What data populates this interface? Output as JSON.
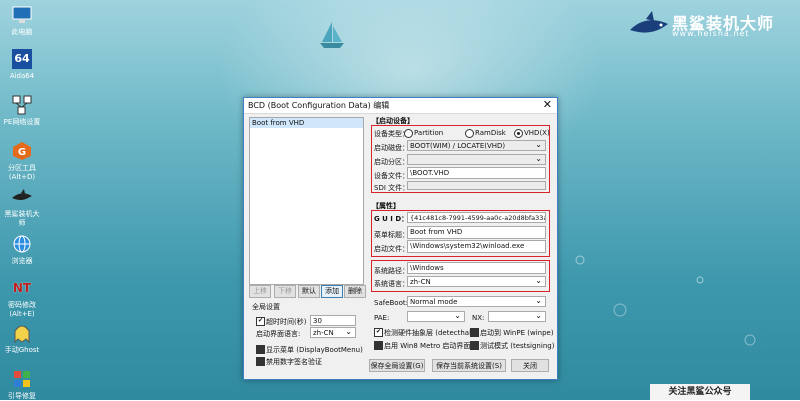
{
  "desktop": {
    "icons": [
      {
        "label": "此电脑",
        "icon": "computer-icon"
      },
      {
        "label": "Aida64",
        "icon": "aida64-icon",
        "glyph": "64"
      },
      {
        "label": "PE网络设置",
        "icon": "network-icon"
      },
      {
        "label": "分区工具\n(Alt+D)",
        "icon": "partition-tool-icon"
      },
      {
        "label": "黑鲨装机大\n师",
        "icon": "shark-installer-icon"
      },
      {
        "label": "浏览器",
        "icon": "browser-icon"
      },
      {
        "label": "密码修改\n(Alt+E)",
        "icon": "password-icon",
        "glyph": "NT"
      },
      {
        "label": "手动Ghost",
        "icon": "ghost-icon"
      },
      {
        "label": "引导修复",
        "icon": "boot-repair-icon"
      }
    ],
    "logo_title": "黑鲨装机大师",
    "logo_url": "www.heisha.net",
    "promo": "关注黑鲨公众号"
  },
  "window": {
    "title": "BCD (Boot Configuration Data) 编辑",
    "close": "✕",
    "list_items": [
      "Boot from VHD"
    ],
    "buttons": {
      "up": "上移",
      "down": "下移",
      "default": "默认",
      "add": "添加",
      "delete": "删除"
    },
    "global": {
      "title": "全局设置",
      "timeout_label": "超时时间(秒)",
      "timeout_value": "30",
      "menu_lang_label": "启动界面语言:",
      "menu_lang_value": "zh-CN",
      "display_menu": "显示菜单 (DisplayBootMenu)",
      "disable_sig": "禁用数字签名验证"
    },
    "boot_device": {
      "title": "【启动设备】",
      "type_label": "设备类型：",
      "type_options": [
        "Partition",
        "RamDisk",
        "VHD(X)"
      ],
      "disk_label": "启动磁盘：",
      "disk_value": "BOOT(WIM) / LOCATE(VHD)",
      "partition_label": "启动分区：",
      "device_file_label": "设备文件：",
      "device_file_value": "\\BOOT.VHD",
      "sdi_label": "SDI 文件："
    },
    "attributes": {
      "title": "【属性】",
      "guid_label": "G U I D：",
      "guid_value": "{41c481c8-7991-4599-aa0c-a20d8bfa33a5}",
      "menu_title_label": "菜单标题：",
      "menu_title_value": "Boot from VHD",
      "boot_file_label": "启动文件：",
      "boot_file_value": "\\Windows\\system32\\winload.exe",
      "sys_path_label": "系统路径：",
      "sys_path_value": "\\Windows",
      "sys_lang_label": "系统语言：",
      "sys_lang_value": "zh-CN"
    },
    "advanced": {
      "safeboot_label": "SafeBoot:",
      "safeboot_value": "Normal mode",
      "pae_label": "PAE:",
      "nx_label": "NX:",
      "detecthal": "检测硬件抽象层 (detecthal)",
      "winpe": "启动到 WinPE (winpe)",
      "metro": "启用 Win8 Metro 启动界面",
      "testsigning": "测试模式 (testsigning)"
    },
    "footer": {
      "save_global": "保存全局设置(G)",
      "save_current": "保存当前系统设置(S)",
      "close": "关闭"
    }
  }
}
